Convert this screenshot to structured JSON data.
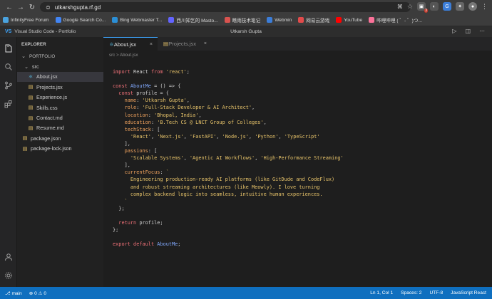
{
  "browser": {
    "url": "utkarshgupta.rf.gd",
    "bookmarks": [
      {
        "label": "InfinityFree Forum",
        "color": "#4aa3df"
      },
      {
        "label": "Google Search Co...",
        "color": "#4285f4"
      },
      {
        "label": "Bing Webmaster T...",
        "color": "#2b8fd6"
      },
      {
        "label": "西川知乞的 Masto...",
        "color": "#6364ff"
      },
      {
        "label": "瞧雨技术笔记",
        "color": "#d9534f"
      },
      {
        "label": "Webmin",
        "color": "#3b7dd8"
      },
      {
        "label": "网易云游戏",
        "color": "#e24b4b"
      },
      {
        "label": "YouTube",
        "color": "#ff0000"
      },
      {
        "label": "哔哩哔哩 ( ゜- ゜)つ...",
        "color": "#fb7299"
      }
    ],
    "badge_count": "3"
  },
  "window": {
    "logo": "VS",
    "app_title": "Visual Studio Code - Portfolio",
    "center_title": "Utkarsh Gupta"
  },
  "sidebar": {
    "header": "EXPLORER",
    "folder": "PORTFOLIO",
    "subfolder": "src",
    "files": [
      {
        "name": "About.jsx",
        "icon": "react-icon",
        "color": "#5cc8f0",
        "selected": true
      },
      {
        "name": "Projects.jsx",
        "icon": "file-icon",
        "color": "#e8c46a",
        "selected": false
      },
      {
        "name": "Experience.js",
        "icon": "file-icon",
        "color": "#e8c46a",
        "selected": false
      },
      {
        "name": "Skills.css",
        "icon": "file-icon",
        "color": "#e8c46a",
        "selected": false
      },
      {
        "name": "Contact.md",
        "icon": "file-icon",
        "color": "#e8c46a",
        "selected": false
      },
      {
        "name": "Resume.md",
        "icon": "file-icon",
        "color": "#e8c46a",
        "selected": false
      }
    ],
    "root_files": [
      {
        "name": "package.json",
        "icon": "file-icon",
        "color": "#e8c46a"
      },
      {
        "name": "package-lock.json",
        "icon": "file-icon",
        "color": "#e8c46a"
      }
    ]
  },
  "editor": {
    "tabs": [
      {
        "label": "About.jsx",
        "active": true
      },
      {
        "label": "Projects.jsx",
        "active": false
      }
    ],
    "breadcrumb": "src > About.jsx",
    "code_lines": [
      [
        {
          "t": "import ",
          "c": "kw"
        },
        {
          "t": "React ",
          "c": "pn"
        },
        {
          "t": "from ",
          "c": "kw"
        },
        {
          "t": "'react'",
          "c": "str"
        },
        {
          "t": ";",
          "c": "pn"
        }
      ],
      [],
      [
        {
          "t": "const ",
          "c": "kw"
        },
        {
          "t": "AboutMe",
          "c": "fn"
        },
        {
          "t": " = () => {",
          "c": "pn"
        }
      ],
      [
        {
          "t": "  const ",
          "c": "kw"
        },
        {
          "t": "profile = {",
          "c": "pn"
        }
      ],
      [
        {
          "t": "    name",
          "c": "prop"
        },
        {
          "t": ": ",
          "c": "pn"
        },
        {
          "t": "'Utkarsh Gupta'",
          "c": "str"
        },
        {
          "t": ",",
          "c": "pn"
        }
      ],
      [
        {
          "t": "    role",
          "c": "prop"
        },
        {
          "t": ": ",
          "c": "pn"
        },
        {
          "t": "'Full-Stack Developer & AI Architect'",
          "c": "str"
        },
        {
          "t": ",",
          "c": "pn"
        }
      ],
      [
        {
          "t": "    location",
          "c": "prop"
        },
        {
          "t": ": ",
          "c": "pn"
        },
        {
          "t": "'Bhopal, India'",
          "c": "str"
        },
        {
          "t": ",",
          "c": "pn"
        }
      ],
      [
        {
          "t": "    education",
          "c": "prop"
        },
        {
          "t": ": ",
          "c": "pn"
        },
        {
          "t": "'B.Tech CS @ LNCT Group of Colleges'",
          "c": "str"
        },
        {
          "t": ",",
          "c": "pn"
        }
      ],
      [
        {
          "t": "    techStack",
          "c": "prop"
        },
        {
          "t": ": [",
          "c": "pn"
        }
      ],
      [
        {
          "t": "      ",
          "c": "pn"
        },
        {
          "t": "'React'",
          "c": "str"
        },
        {
          "t": ", ",
          "c": "pn"
        },
        {
          "t": "'Next.js'",
          "c": "str"
        },
        {
          "t": ", ",
          "c": "pn"
        },
        {
          "t": "'FastAPI'",
          "c": "str"
        },
        {
          "t": ", ",
          "c": "pn"
        },
        {
          "t": "'Node.js'",
          "c": "str"
        },
        {
          "t": ", ",
          "c": "pn"
        },
        {
          "t": "'Python'",
          "c": "str"
        },
        {
          "t": ", ",
          "c": "pn"
        },
        {
          "t": "'TypeScript'",
          "c": "str"
        }
      ],
      [
        {
          "t": "    ],",
          "c": "pn"
        }
      ],
      [
        {
          "t": "    passions",
          "c": "prop"
        },
        {
          "t": ": [",
          "c": "pn"
        }
      ],
      [
        {
          "t": "      ",
          "c": "pn"
        },
        {
          "t": "'Scalable Systems'",
          "c": "str"
        },
        {
          "t": ", ",
          "c": "pn"
        },
        {
          "t": "'Agentic AI Workflows'",
          "c": "str"
        },
        {
          "t": ", ",
          "c": "pn"
        },
        {
          "t": "'High-Performance Streaming'",
          "c": "str"
        }
      ],
      [
        {
          "t": "    ],",
          "c": "pn"
        }
      ],
      [
        {
          "t": "    currentFocus",
          "c": "prop"
        },
        {
          "t": ": ",
          "c": "pn"
        },
        {
          "t": "`",
          "c": "str"
        }
      ],
      [
        {
          "t": "      Engineering production-ready AI platforms (like GitDude and CodeFlux)",
          "c": "str"
        }
      ],
      [
        {
          "t": "      and robust streaming architectures (like Meowly). I love turning",
          "c": "str"
        }
      ],
      [
        {
          "t": "      complex backend logic into seamless, intuitive human experiences.",
          "c": "str"
        }
      ],
      [
        {
          "t": "    `",
          "c": "str"
        }
      ],
      [
        {
          "t": "  };",
          "c": "pn"
        }
      ],
      [],
      [
        {
          "t": "  return ",
          "c": "kw"
        },
        {
          "t": "profile;",
          "c": "pn"
        }
      ],
      [
        {
          "t": "};",
          "c": "pn"
        }
      ],
      [],
      [
        {
          "t": "export ",
          "c": "kw"
        },
        {
          "t": "default ",
          "c": "kw"
        },
        {
          "t": "AboutMe",
          "c": "fn"
        },
        {
          "t": ";",
          "c": "pn"
        }
      ]
    ]
  },
  "status": {
    "branch": "main",
    "problems": "⊗ 0 ⚠ 0",
    "position": "Ln 1, Col 1",
    "spaces": "Spaces: 2",
    "encoding": "UTF-8",
    "language": "JavaScript React"
  },
  "colors": {
    "accent": "#0f6fbf",
    "keyword": "#f07178",
    "string": "#e8c46a",
    "property": "#f0a35e",
    "function": "#82aaff"
  }
}
